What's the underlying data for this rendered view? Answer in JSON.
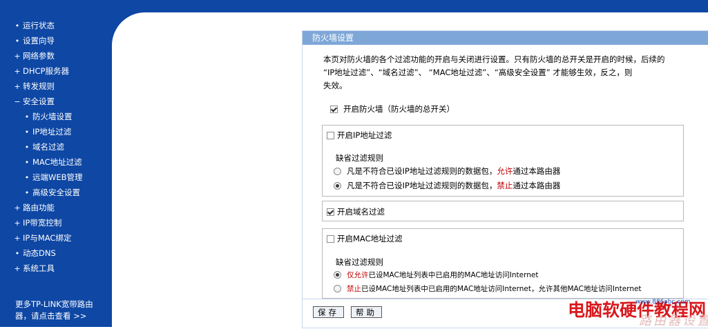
{
  "sidebar": {
    "items": [
      {
        "label": "运行状态",
        "marker": "•",
        "level": "top"
      },
      {
        "label": "设置向导",
        "marker": "•",
        "level": "top"
      },
      {
        "label": "网络参数",
        "marker": "+",
        "level": "top"
      },
      {
        "label": "DHCP服务器",
        "marker": "+",
        "level": "top"
      },
      {
        "label": "转发规则",
        "marker": "+",
        "level": "top"
      },
      {
        "label": "安全设置",
        "marker": "−",
        "level": "top"
      },
      {
        "label": "防火墙设置",
        "marker": "•",
        "level": "sub"
      },
      {
        "label": "IP地址过滤",
        "marker": "•",
        "level": "sub"
      },
      {
        "label": "域名过滤",
        "marker": "•",
        "level": "sub"
      },
      {
        "label": "MAC地址过滤",
        "marker": "•",
        "level": "sub"
      },
      {
        "label": "远端WEB管理",
        "marker": "•",
        "level": "sub"
      },
      {
        "label": "高级安全设置",
        "marker": "•",
        "level": "sub"
      },
      {
        "label": "路由功能",
        "marker": "+",
        "level": "top"
      },
      {
        "label": "IP带宽控制",
        "marker": "+",
        "level": "top"
      },
      {
        "label": "IP与MAC绑定",
        "marker": "+",
        "level": "top"
      },
      {
        "label": "动态DNS",
        "marker": "•",
        "level": "top"
      },
      {
        "label": "系统工具",
        "marker": "+",
        "level": "top"
      }
    ],
    "more_line1": "更多TP-LINK宽带路由",
    "more_line2": "器，请点击查看 >>"
  },
  "panel": {
    "title": "防火墙设置",
    "desc_line1": "本页对防火墙的各个过滤功能的开启与关闭进行设置。只有防火墙的总开关是开启的时候，后续的",
    "desc_line2": "“IP地址过滤”、“域名过滤”、 “MAC地址过滤”、“高级安全设置” 才能够生效，反之，则",
    "desc_line3": "失效。",
    "firewall_label": "开启防火墙（防火墙的总开关）",
    "firewall_checked": true,
    "ip_filter": {
      "label": "开启IP地址过滤",
      "checked": false,
      "default_rule": "缺省过滤规则",
      "opt1_pre": "凡是不符合已设IP地址过滤规则的数据包，",
      "opt1_red": "允许",
      "opt1_post": "通过本路由器",
      "opt2_pre": "凡是不符合已设IP地址过滤规则的数据包，",
      "opt2_red": "禁止",
      "opt2_post": "通过本路由器",
      "selected": 2
    },
    "domain_filter": {
      "label": "开启域名过滤",
      "checked": true
    },
    "mac_filter": {
      "label": "开启MAC地址过滤",
      "checked": false,
      "default_rule": "缺省过滤规则",
      "opt1_red": "仅允许",
      "opt1_post": "已设MAC地址列表中已启用的MAC地址访问Internet",
      "opt2_red": "禁止",
      "opt2_post": "已设MAC地址列表中已启用的MAC地址访问Internet，允许其他MAC地址访问Internet",
      "selected": 1
    },
    "save_button": "保存",
    "help_button": "帮助"
  },
  "watermark": {
    "main": "电脑软硬件教程网",
    "url": "www.886abc.com",
    "sub": "路由器设置"
  },
  "colors": {
    "sidebar_bg": "#0e47a4",
    "panel_title_bg": "#7ea7d8",
    "accent_red": "#c00000"
  }
}
